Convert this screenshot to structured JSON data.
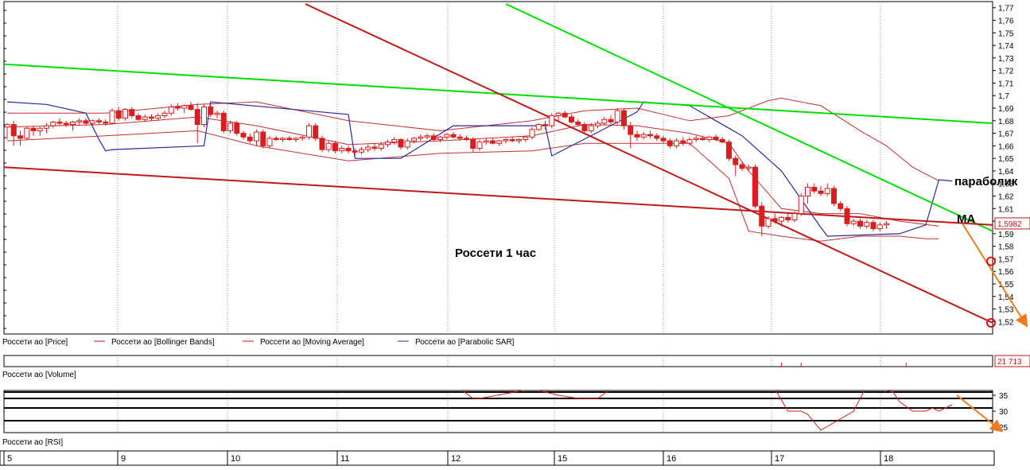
{
  "chart_data": [
    {
      "type": "candlestick",
      "panel": "price",
      "annotations": {
        "title": "Россети    1 час",
        "parabolic_label": "параболик",
        "ma_label": "МА"
      },
      "y_ticks": [
        "1,52",
        "1,53",
        "1,54",
        "1,55",
        "1,56",
        "1,57",
        "1,58",
        "1,59",
        "1,6",
        "1,61",
        "1,62",
        "1,63",
        "1,64",
        "1,65",
        "1,66",
        "1,67",
        "1,68",
        "1,69",
        "1,7",
        "1,71",
        "1,72",
        "1,73",
        "1,74",
        "1,75",
        "1,76",
        "1,77"
      ],
      "ylim": [
        1.512,
        1.773
      ],
      "last_price_label": "1,5982",
      "x_day_labels": [
        "5",
        "9",
        "10",
        "11",
        "12",
        "15",
        "16",
        "17",
        "18"
      ],
      "candles": [
        [
          1.675,
          1.678,
          1.665,
          1.677
        ],
        [
          1.677,
          1.68,
          1.66,
          1.668
        ],
        [
          1.668,
          1.672,
          1.66,
          1.666
        ],
        [
          1.666,
          1.675,
          1.665,
          1.674
        ],
        [
          1.674,
          1.676,
          1.668,
          1.672
        ],
        [
          1.672,
          1.675,
          1.668,
          1.674
        ],
        [
          1.674,
          1.678,
          1.67,
          1.676
        ],
        [
          1.676,
          1.68,
          1.674,
          1.679
        ],
        [
          1.679,
          1.682,
          1.676,
          1.678
        ],
        [
          1.678,
          1.68,
          1.675,
          1.677
        ],
        [
          1.677,
          1.68,
          1.672,
          1.679
        ],
        [
          1.679,
          1.682,
          1.676,
          1.68
        ],
        [
          1.68,
          1.682,
          1.676,
          1.678
        ],
        [
          1.678,
          1.681,
          1.675,
          1.68
        ],
        [
          1.68,
          1.682,
          1.677,
          1.679
        ],
        [
          1.679,
          1.681,
          1.676,
          1.678
        ],
        [
          1.678,
          1.69,
          1.677,
          1.688
        ],
        [
          1.688,
          1.691,
          1.68,
          1.682
        ],
        [
          1.682,
          1.69,
          1.68,
          1.689
        ],
        [
          1.689,
          1.691,
          1.682,
          1.684
        ],
        [
          1.684,
          1.686,
          1.68,
          1.681
        ],
        [
          1.681,
          1.685,
          1.679,
          1.683
        ],
        [
          1.683,
          1.685,
          1.68,
          1.682
        ],
        [
          1.682,
          1.686,
          1.68,
          1.684
        ],
        [
          1.684,
          1.688,
          1.682,
          1.686
        ],
        [
          1.686,
          1.693,
          1.684,
          1.691
        ],
        [
          1.691,
          1.694,
          1.688,
          1.69
        ],
        [
          1.69,
          1.693,
          1.686,
          1.692
        ],
        [
          1.692,
          1.695,
          1.688,
          1.689
        ],
        [
          1.689,
          1.694,
          1.662,
          1.677
        ],
        [
          1.677,
          1.693,
          1.675,
          1.691
        ],
        [
          1.691,
          1.693,
          1.683,
          1.685
        ],
        [
          1.685,
          1.688,
          1.682,
          1.686
        ],
        [
          1.686,
          1.688,
          1.67,
          1.672
        ],
        [
          1.672,
          1.68,
          1.67,
          1.678
        ],
        [
          1.678,
          1.68,
          1.668,
          1.67
        ],
        [
          1.67,
          1.672,
          1.665,
          1.667
        ],
        [
          1.667,
          1.67,
          1.662,
          1.664
        ],
        [
          1.664,
          1.673,
          1.66,
          1.671
        ],
        [
          1.671,
          1.673,
          1.658,
          1.66
        ],
        [
          1.66,
          1.668,
          1.658,
          1.666
        ],
        [
          1.666,
          1.668,
          1.664,
          1.665
        ],
        [
          1.665,
          1.667,
          1.663,
          1.666
        ],
        [
          1.666,
          1.668,
          1.664,
          1.665
        ],
        [
          1.665,
          1.667,
          1.663,
          1.666
        ],
        [
          1.666,
          1.668,
          1.664,
          1.667
        ],
        [
          1.667,
          1.678,
          1.665,
          1.676
        ],
        [
          1.676,
          1.678,
          1.664,
          1.666
        ],
        [
          1.666,
          1.668,
          1.655,
          1.657
        ],
        [
          1.657,
          1.664,
          1.655,
          1.662
        ],
        [
          1.662,
          1.664,
          1.654,
          1.656
        ],
        [
          1.656,
          1.66,
          1.654,
          1.658
        ],
        [
          1.658,
          1.66,
          1.654,
          1.656
        ],
        [
          1.656,
          1.658,
          1.652,
          1.655
        ],
        [
          1.655,
          1.659,
          1.653,
          1.657
        ],
        [
          1.657,
          1.661,
          1.655,
          1.659
        ],
        [
          1.659,
          1.662,
          1.656,
          1.658
        ],
        [
          1.658,
          1.663,
          1.656,
          1.661
        ],
        [
          1.661,
          1.665,
          1.659,
          1.663
        ],
        [
          1.663,
          1.667,
          1.661,
          1.665
        ],
        [
          1.665,
          1.666,
          1.657,
          1.659
        ],
        [
          1.659,
          1.666,
          1.657,
          1.664
        ],
        [
          1.664,
          1.667,
          1.662,
          1.666
        ],
        [
          1.666,
          1.669,
          1.664,
          1.667
        ],
        [
          1.667,
          1.67,
          1.665,
          1.668
        ],
        [
          1.668,
          1.67,
          1.664,
          1.665
        ],
        [
          1.665,
          1.668,
          1.663,
          1.667
        ],
        [
          1.667,
          1.67,
          1.665,
          1.669
        ],
        [
          1.669,
          1.671,
          1.666,
          1.667
        ],
        [
          1.667,
          1.669,
          1.664,
          1.666
        ],
        [
          1.666,
          1.668,
          1.664,
          1.665
        ],
        [
          1.665,
          1.667,
          1.655,
          1.658
        ],
        [
          1.658,
          1.665,
          1.656,
          1.663
        ],
        [
          1.663,
          1.666,
          1.661,
          1.664
        ],
        [
          1.664,
          1.666,
          1.661,
          1.662
        ],
        [
          1.662,
          1.665,
          1.66,
          1.664
        ],
        [
          1.664,
          1.666,
          1.662,
          1.665
        ],
        [
          1.665,
          1.667,
          1.663,
          1.664
        ],
        [
          1.664,
          1.666,
          1.662,
          1.665
        ],
        [
          1.665,
          1.668,
          1.663,
          1.667
        ],
        [
          1.667,
          1.675,
          1.665,
          1.673
        ],
        [
          1.673,
          1.678,
          1.672,
          1.677
        ],
        [
          1.677,
          1.68,
          1.673,
          1.676
        ],
        [
          1.676,
          1.686,
          1.674,
          1.684
        ],
        [
          1.684,
          1.687,
          1.68,
          1.686
        ],
        [
          1.686,
          1.688,
          1.682,
          1.683
        ],
        [
          1.683,
          1.685,
          1.678,
          1.679
        ],
        [
          1.679,
          1.681,
          1.676,
          1.677
        ],
        [
          1.677,
          1.679,
          1.67,
          1.672
        ],
        [
          1.672,
          1.678,
          1.67,
          1.676
        ],
        [
          1.676,
          1.68,
          1.674,
          1.678
        ],
        [
          1.678,
          1.683,
          1.676,
          1.681
        ],
        [
          1.681,
          1.684,
          1.677,
          1.679
        ],
        [
          1.679,
          1.69,
          1.677,
          1.688
        ],
        [
          1.688,
          1.69,
          1.673,
          1.676
        ],
        [
          1.676,
          1.679,
          1.658,
          1.669
        ],
        [
          1.669,
          1.672,
          1.664,
          1.667
        ],
        [
          1.667,
          1.671,
          1.665,
          1.669
        ],
        [
          1.669,
          1.672,
          1.666,
          1.668
        ],
        [
          1.668,
          1.67,
          1.664,
          1.666
        ],
        [
          1.666,
          1.668,
          1.662,
          1.664
        ],
        [
          1.664,
          1.666,
          1.658,
          1.66
        ],
        [
          1.66,
          1.666,
          1.658,
          1.664
        ],
        [
          1.664,
          1.667,
          1.66,
          1.662
        ],
        [
          1.662,
          1.667,
          1.66,
          1.665
        ],
        [
          1.665,
          1.668,
          1.663,
          1.666
        ],
        [
          1.666,
          1.668,
          1.664,
          1.665
        ],
        [
          1.665,
          1.668,
          1.663,
          1.667
        ],
        [
          1.667,
          1.669,
          1.664,
          1.665
        ],
        [
          1.665,
          1.667,
          1.662,
          1.663
        ],
        [
          1.663,
          1.665,
          1.648,
          1.65
        ],
        [
          1.65,
          1.652,
          1.636,
          1.645
        ],
        [
          1.645,
          1.647,
          1.64,
          1.642
        ],
        [
          1.642,
          1.645,
          1.64,
          1.643
        ],
        [
          1.643,
          1.645,
          1.61,
          1.612
        ],
        [
          1.612,
          1.615,
          1.588,
          1.596
        ],
        [
          1.596,
          1.604,
          1.594,
          1.602
        ],
        [
          1.602,
          1.606,
          1.598,
          1.6
        ],
        [
          1.6,
          1.604,
          1.596,
          1.603
        ],
        [
          1.603,
          1.606,
          1.599,
          1.601
        ],
        [
          1.601,
          1.608,
          1.599,
          1.606
        ],
        [
          1.606,
          1.622,
          1.604,
          1.62
        ],
        [
          1.62,
          1.63,
          1.614,
          1.627
        ],
        [
          1.627,
          1.63,
          1.622,
          1.624
        ],
        [
          1.624,
          1.628,
          1.62,
          1.622
        ],
        [
          1.622,
          1.63,
          1.62,
          1.626
        ],
        [
          1.626,
          1.628,
          1.612,
          1.614
        ],
        [
          1.614,
          1.616,
          1.608,
          1.61
        ],
        [
          1.61,
          1.612,
          1.596,
          1.598
        ],
        [
          1.598,
          1.602,
          1.596,
          1.6
        ],
        [
          1.6,
          1.602,
          1.594,
          1.596
        ],
        [
          1.596,
          1.601,
          1.594,
          1.599
        ],
        [
          1.599,
          1.601,
          1.592,
          1.594
        ],
        [
          1.594,
          1.599,
          1.592,
          1.597
        ],
        [
          1.597,
          1.6,
          1.594,
          1.598
        ]
      ],
      "bollinger_upper": [
        [
          0,
          1.686
        ],
        [
          15,
          1.686
        ],
        [
          29,
          1.693
        ],
        [
          38,
          1.695
        ],
        [
          52,
          1.68
        ],
        [
          66,
          1.672
        ],
        [
          80,
          1.68
        ],
        [
          88,
          1.688
        ],
        [
          96,
          1.69
        ],
        [
          104,
          1.68
        ],
        [
          110,
          1.684
        ],
        [
          116,
          1.696
        ],
        [
          118,
          1.698
        ],
        [
          124,
          1.692
        ],
        [
          130,
          1.672
        ],
        [
          134,
          1.66
        ],
        [
          138,
          1.643
        ],
        [
          142,
          1.632
        ]
      ],
      "bollinger_lower": [
        [
          0,
          1.664
        ],
        [
          15,
          1.668
        ],
        [
          29,
          1.672
        ],
        [
          38,
          1.66
        ],
        [
          52,
          1.648
        ],
        [
          66,
          1.654
        ],
        [
          80,
          1.656
        ],
        [
          88,
          1.662
        ],
        [
          96,
          1.662
        ],
        [
          104,
          1.662
        ],
        [
          110,
          1.634
        ],
        [
          113,
          1.592
        ],
        [
          118,
          1.588
        ],
        [
          124,
          1.584
        ],
        [
          130,
          1.588
        ],
        [
          136,
          1.588
        ],
        [
          140,
          1.586
        ],
        [
          142,
          1.586
        ]
      ],
      "moving_average": [
        [
          0,
          1.675
        ],
        [
          15,
          1.677
        ],
        [
          29,
          1.683
        ],
        [
          38,
          1.676
        ],
        [
          52,
          1.661
        ],
        [
          66,
          1.664
        ],
        [
          80,
          1.668
        ],
        [
          88,
          1.677
        ],
        [
          96,
          1.676
        ],
        [
          104,
          1.67
        ],
        [
          110,
          1.662
        ],
        [
          113,
          1.64
        ],
        [
          118,
          1.61
        ],
        [
          124,
          1.606
        ],
        [
          130,
          1.606
        ],
        [
          136,
          1.6
        ],
        [
          142,
          1.596
        ]
      ],
      "parabolic_sar": [
        [
          0,
          1.695
        ],
        [
          6,
          1.693
        ],
        [
          12,
          1.686
        ],
        [
          14,
          1.665
        ],
        [
          15,
          1.656
        ],
        [
          16,
          1.657
        ],
        [
          30,
          1.66
        ],
        [
          31,
          1.695
        ],
        [
          52,
          1.685
        ],
        [
          53,
          1.65
        ],
        [
          60,
          1.65
        ],
        [
          68,
          1.676
        ],
        [
          82,
          1.676
        ],
        [
          83,
          1.652
        ],
        [
          96,
          1.687
        ],
        [
          97,
          1.695
        ],
        [
          104,
          1.692
        ],
        [
          112,
          1.668
        ],
        [
          118,
          1.64
        ],
        [
          124,
          1.595
        ],
        [
          125,
          1.588
        ],
        [
          136,
          1.59
        ],
        [
          140,
          1.597
        ],
        [
          142,
          1.633
        ],
        [
          144,
          1.632
        ]
      ],
      "trendlines": [
        {
          "color": "#00e000",
          "from": [
            1.725
          ],
          "to": [
            1.678
          ]
        },
        {
          "color": "#00e000",
          "from": [
            1.773
          ],
          "to": [
            1.592
          ]
        },
        {
          "color": "#c01818",
          "from": [
            1.643
          ],
          "to": [
            1.597
          ]
        },
        {
          "color": "#c01818",
          "from": [
            1.773
          ],
          "to": [
            1.519
          ]
        }
      ],
      "forecast_arrows": [
        {
          "panel": "price",
          "from": [
            1.598
          ],
          "to": [
            1.52
          ]
        },
        {
          "panel": "rsi",
          "from": [
            35
          ],
          "to": [
            25
          ]
        }
      ],
      "forecast_markers": [
        1.568,
        1.519
      ]
    },
    {
      "type": "line",
      "panel": "volume",
      "label": "Россети ао [Volume]",
      "last_value_label": "21 713"
    },
    {
      "type": "line",
      "panel": "rsi",
      "label": "Россети ао [RSI]",
      "y_ticks": [
        "25",
        "30",
        "35"
      ],
      "levels": [
        27,
        31,
        34,
        36
      ],
      "values": [
        [
          69,
          37
        ],
        [
          71,
          34
        ],
        [
          72,
          34
        ],
        [
          80,
          37
        ],
        [
          84,
          35
        ],
        [
          87,
          34
        ],
        [
          90,
          34
        ],
        [
          92,
          37
        ],
        [
          117,
          37
        ],
        [
          119,
          30
        ],
        [
          121,
          30
        ],
        [
          122,
          29
        ],
        [
          124,
          24
        ],
        [
          129,
          30
        ],
        [
          131,
          38
        ],
        [
          135,
          36
        ],
        [
          136,
          33
        ],
        [
          138,
          30
        ],
        [
          140,
          30
        ],
        [
          141,
          31
        ],
        [
          142,
          30
        ],
        [
          144,
          32
        ]
      ]
    }
  ],
  "legend": [
    {
      "label": "Россети ао [Price]",
      "color": "#c01818"
    },
    {
      "label": "Россети ао [Bollinger Bands]",
      "color": "#c01818"
    },
    {
      "label": "Россети ао [Moving Average]",
      "color": "#c01818"
    },
    {
      "label": "Россети ао [Parabolic SAR]",
      "color": "#2a2a9a"
    }
  ],
  "colors": {
    "price": "#d81e1e",
    "band": "#c43030",
    "ma": "#c43030",
    "sar": "#2a2a9a",
    "trend_green": "#00e000",
    "trend_red": "#c01818",
    "forecast": "#f07b1e"
  }
}
